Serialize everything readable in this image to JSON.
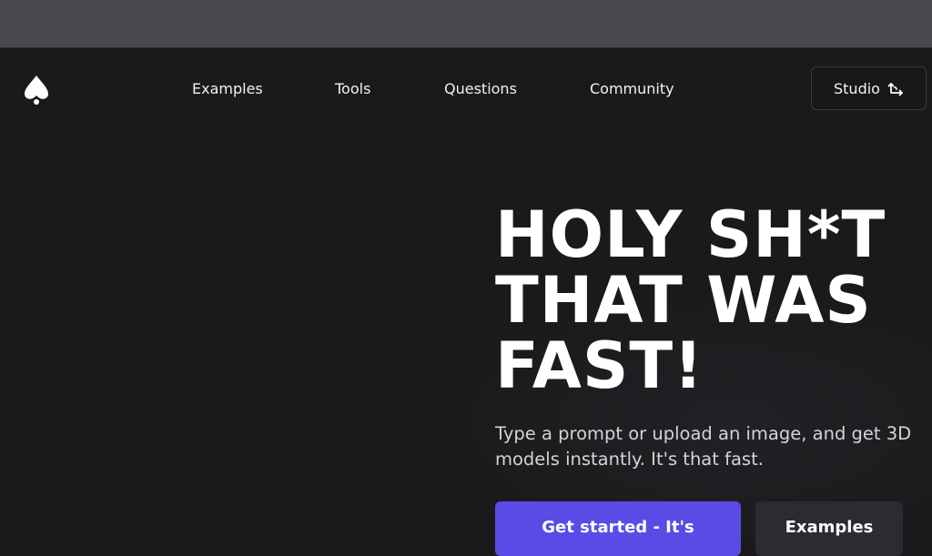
{
  "nav": {
    "logo_icon": "spade-logo-icon",
    "links": [
      "Examples",
      "Tools",
      "Questions",
      "Community"
    ],
    "studio_label": "Studio",
    "studio_icon": "arrow-corner-icon"
  },
  "hero": {
    "title_lines": [
      "HOLY SH*T",
      "THAT WAS",
      "FAST!"
    ],
    "subtitle": "Type a prompt or upload an image, and get 3D models instantly. It's that fast.",
    "primary_cta": "Get started - It's",
    "secondary_cta": "Examples"
  },
  "colors": {
    "background": "#1a1a1c",
    "topbar": "#49494d",
    "accent": "#5b4be6",
    "secondary_button": "#2c2c30"
  }
}
